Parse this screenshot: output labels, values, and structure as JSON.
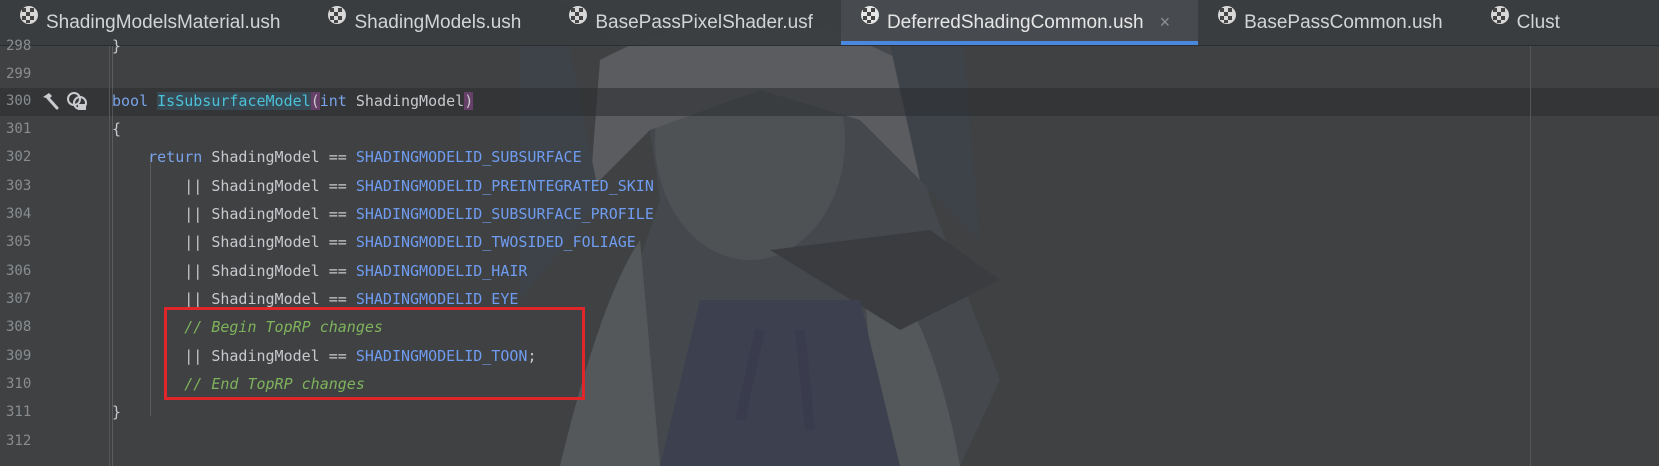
{
  "tabs": [
    {
      "label": "ShadingModelsMaterial.ush",
      "active": false
    },
    {
      "label": "ShadingModels.ush",
      "active": false
    },
    {
      "label": "BasePassPixelShader.usf",
      "active": false
    },
    {
      "label": "DeferredShadingCommon.ush",
      "active": true,
      "close": "×"
    },
    {
      "label": "BasePassCommon.ush",
      "active": false
    },
    {
      "label": "Clust",
      "active": false
    }
  ],
  "gutter": {
    "line_numbers": [
      "298",
      "299",
      "300",
      "301",
      "302",
      "303",
      "304",
      "305",
      "306",
      "307",
      "308",
      "309",
      "310",
      "311",
      "312"
    ]
  },
  "code": {
    "line_298": "}",
    "line_300": {
      "kw": "bool",
      "fn": "IsSubsurfaceModel",
      "open": "(",
      "type": "int",
      "param": " ShadingModel",
      "close": ")"
    },
    "line_301": "{",
    "line_302": {
      "kw": "return",
      "lhs": " ShadingModel == ",
      "const": "SHADINGMODELID_SUBSURFACE"
    },
    "line_303": {
      "op": "|| ShadingModel == ",
      "const": "SHADINGMODELID_PREINTEGRATED_SKIN"
    },
    "line_304": {
      "op": "|| ShadingModel == ",
      "const": "SHADINGMODELID_SUBSURFACE_PROFILE"
    },
    "line_305": {
      "op": "|| ShadingModel == ",
      "const": "SHADINGMODELID_TWOSIDED_FOLIAGE"
    },
    "line_306": {
      "op": "|| ShadingModel == ",
      "const": "SHADINGMODELID_HAIR"
    },
    "line_307": {
      "op": "|| ShadingModel == ",
      "const": "SHADINGMODELID_EYE"
    },
    "line_308": "// Begin TopRP changes",
    "line_309": {
      "op": "|| ShadingModel == ",
      "const": "SHADINGMODELID_TOON",
      "end": ";"
    },
    "line_310": "// End TopRP changes",
    "line_311": "}"
  },
  "colors": {
    "keyword": "#7aa2e8",
    "function": "#49c2d8",
    "constant": "#6f9cf0",
    "comment": "#7fb35c",
    "highlight_box": "#e0262a",
    "active_tab_underline": "#4a88e0"
  },
  "icons": [
    "file-icon",
    "hammer-icon",
    "implementations-icon",
    "close-icon"
  ]
}
